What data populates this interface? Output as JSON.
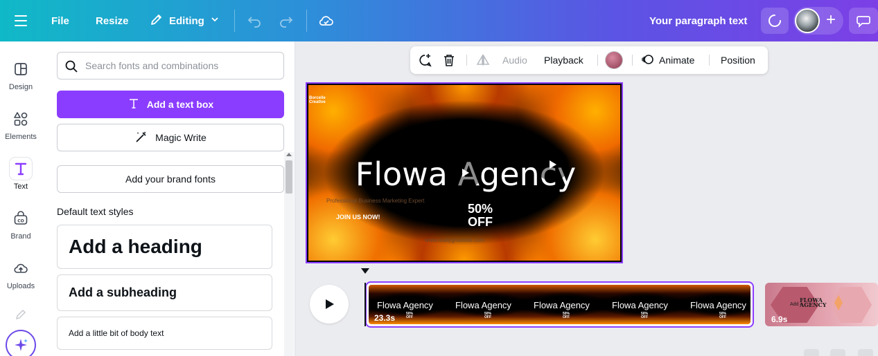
{
  "topbar": {
    "file": "File",
    "resize": "Resize",
    "editing": "Editing",
    "paragraph_text": "Your paragraph text",
    "gradient_start": "#10b9c7",
    "gradient_end": "#7c3fe6"
  },
  "rail": {
    "items": [
      {
        "label": "Design",
        "icon": "layout-icon"
      },
      {
        "label": "Elements",
        "icon": "shapes-icon"
      },
      {
        "label": "Text",
        "icon": "text-T-icon"
      },
      {
        "label": "Brand",
        "icon": "brand-icon"
      },
      {
        "label": "Uploads",
        "icon": "cloud-upload-icon"
      }
    ]
  },
  "panel": {
    "search_placeholder": "Search fonts and combinations",
    "add_text_box": "Add a text box",
    "magic_write": "Magic Write",
    "brand_fonts": "Add your brand fonts",
    "default_styles": "Default text styles",
    "heading": "Add a heading",
    "subheading": "Add a subheading",
    "body": "Add a little bit of body text",
    "accent_color": "#8b3dff"
  },
  "context_toolbar": {
    "audio": "Audio",
    "playback": "Playback",
    "animate": "Animate",
    "position": "Position",
    "color_swatch": "#b45a6e"
  },
  "slide": {
    "logo": "Borcelle Creative",
    "title": "Flowa Agency",
    "subtitle": "Professional Business Marketing Expert",
    "join": "JOIN US NOW!",
    "offer_line1": "50%",
    "offer_line2": "OFF",
    "url": "www.reallygreatsite.com"
  },
  "timeline": {
    "track1_duration": "23.3s",
    "track1_frame_title": "Flowa Agency",
    "track1_frame_offer_1": "50%",
    "track1_frame_offer_2": "OFF",
    "track2_duration": "6.9s",
    "track2_title_1": "FLOWA",
    "track2_title_2": "AGENCY",
    "track2_sub": "Add a"
  }
}
